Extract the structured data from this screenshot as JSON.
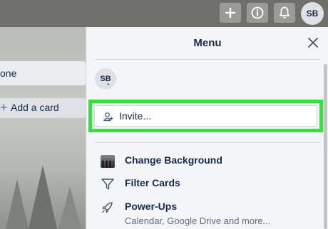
{
  "topbar": {
    "add_icon": "plus-icon",
    "info_icon": "info-icon",
    "bell_icon": "bell-icon",
    "avatar_initials": "SB"
  },
  "board": {
    "card_text": "one",
    "add_card_plus": "+",
    "add_card_label": "Add a card"
  },
  "menu": {
    "title": "Menu",
    "close_icon": "close-icon",
    "member_initials": "SB",
    "member_badge": "^",
    "invite_label": "Invite...",
    "items": [
      {
        "icon": "background-thumbnail",
        "label": "Change Background"
      },
      {
        "icon": "filter-icon",
        "label": "Filter Cards"
      },
      {
        "icon": "rocket-icon",
        "label": "Power-Ups"
      }
    ],
    "powerups_description": "Calendar, Google Drive and more..."
  },
  "colors": {
    "highlight": "#36e23a",
    "topbar": "#6f6f6b",
    "menu_bg": "#f4f5f7",
    "text": "#172b4d"
  }
}
